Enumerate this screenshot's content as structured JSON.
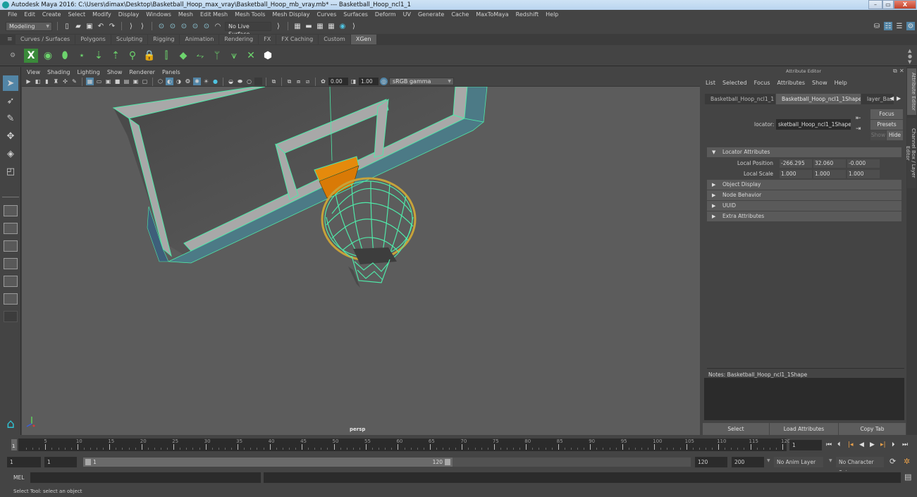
{
  "window": {
    "title": "Autodesk Maya 2016: C:\\Users\\dimax\\Desktop\\Basketball_Hoop_max_vray\\Basketball_Hoop_mb_vray.mb*   ---   Basketball_Hoop_ncl1_1",
    "minimize": "–",
    "restore": "▭",
    "close": "X"
  },
  "menubar": [
    "File",
    "Edit",
    "Create",
    "Select",
    "Modify",
    "Display",
    "Windows",
    "Mesh",
    "Edit Mesh",
    "Mesh Tools",
    "Mesh Display",
    "Curves",
    "Surfaces",
    "Deform",
    "UV",
    "Generate",
    "Cache",
    "MaxToMaya",
    "Redshift",
    "Help"
  ],
  "statusline": {
    "mode": "Modeling",
    "live_surface": "No Live Surface"
  },
  "shelf_tabs": [
    {
      "label": "Curves / Surfaces",
      "active": false
    },
    {
      "label": "Polygons",
      "active": false
    },
    {
      "label": "Sculpting",
      "active": false
    },
    {
      "label": "Rigging",
      "active": false
    },
    {
      "label": "Animation",
      "active": false
    },
    {
      "label": "Rendering",
      "active": false
    },
    {
      "label": "FX",
      "active": false
    },
    {
      "label": "FX Caching",
      "active": false
    },
    {
      "label": "Custom",
      "active": false
    },
    {
      "label": "XGen",
      "active": true
    }
  ],
  "shelf_icons": [
    "xgen-create-description-icon",
    "xgen-preview-icon",
    "xgen-toggle-icon",
    "xgen-add-guide-icon",
    "xgen-place-icon",
    "xgen-sculpt-guide-icon",
    "xgen-guide-visibility-icon",
    "xgen-lock-guide-icon",
    "xgen-guides-icon",
    "xgen-patch-icon",
    "xgen-rebuild-icon",
    "xgen-grass-icon",
    "xgen-bend-icon",
    "xgen-delete-icon",
    "xgen-interactive-groom-icon"
  ],
  "viewport": {
    "menu": [
      "View",
      "Shading",
      "Lighting",
      "Show",
      "Renderer",
      "Panels"
    ],
    "exposure": "0.00",
    "gamma": "1.00",
    "color_space": "sRGB gamma",
    "camera_label": "persp"
  },
  "attribute_editor": {
    "title": "Attribute Editor",
    "menu": [
      "List",
      "Selected",
      "Focus",
      "Attributes",
      "Show",
      "Help"
    ],
    "tabs": [
      {
        "label": "Basketball_Hoop_ncl1_1",
        "active": false
      },
      {
        "label": "Basketball_Hoop_ncl1_1Shape",
        "active": true
      },
      {
        "label": "layer_Bas",
        "active": false
      }
    ],
    "node_type_label": "locator:",
    "node_name": "sketball_Hoop_ncl1_1Shape",
    "focus_btn": "Focus",
    "presets_btn": "Presets",
    "show_btn": "Show",
    "hide_btn": "Hide",
    "sections": [
      {
        "label": "Locator Attributes",
        "expanded": true
      },
      {
        "label": "Object Display",
        "expanded": false
      },
      {
        "label": "Node Behavior",
        "expanded": false
      },
      {
        "label": "UUID",
        "expanded": false
      },
      {
        "label": "Extra Attributes",
        "expanded": false
      }
    ],
    "local_position": {
      "label": "Local Position",
      "x": "-266.295",
      "y": "32.060",
      "z": "-0.000"
    },
    "local_scale": {
      "label": "Local Scale",
      "x": "1.000",
      "y": "1.000",
      "z": "1.000"
    },
    "notes_label": "Notes:  Basketball_Hoop_ncl1_1Shape",
    "notes_value": "",
    "bottom_buttons": [
      "Select",
      "Load Attributes",
      "Copy Tab"
    ]
  },
  "side_tabs": [
    "Attribute Editor",
    "Channel Box / Layer Editor"
  ],
  "timeline": {
    "ticks": [
      5,
      10,
      15,
      20,
      25,
      30,
      35,
      40,
      45,
      50,
      55,
      60,
      65,
      70,
      75,
      80,
      85,
      90,
      95,
      100,
      105,
      110,
      115,
      120
    ],
    "current_frame_marker": "1",
    "current_frame": "1",
    "range_start": "1",
    "playback_start": "1",
    "range_slider_start": "1",
    "range_slider_end": "120",
    "playback_end": "120",
    "range_end": "200",
    "anim_layer": "No Anim Layer",
    "character_set": "No Character Set"
  },
  "command_line": {
    "language": "MEL",
    "input": "",
    "output": ""
  },
  "help_line": "Select Tool: select an object",
  "colors": {
    "wire_green": "#4fe8a8",
    "rim_orange": "#e58a0c",
    "selection_blue": "#5285a6"
  }
}
